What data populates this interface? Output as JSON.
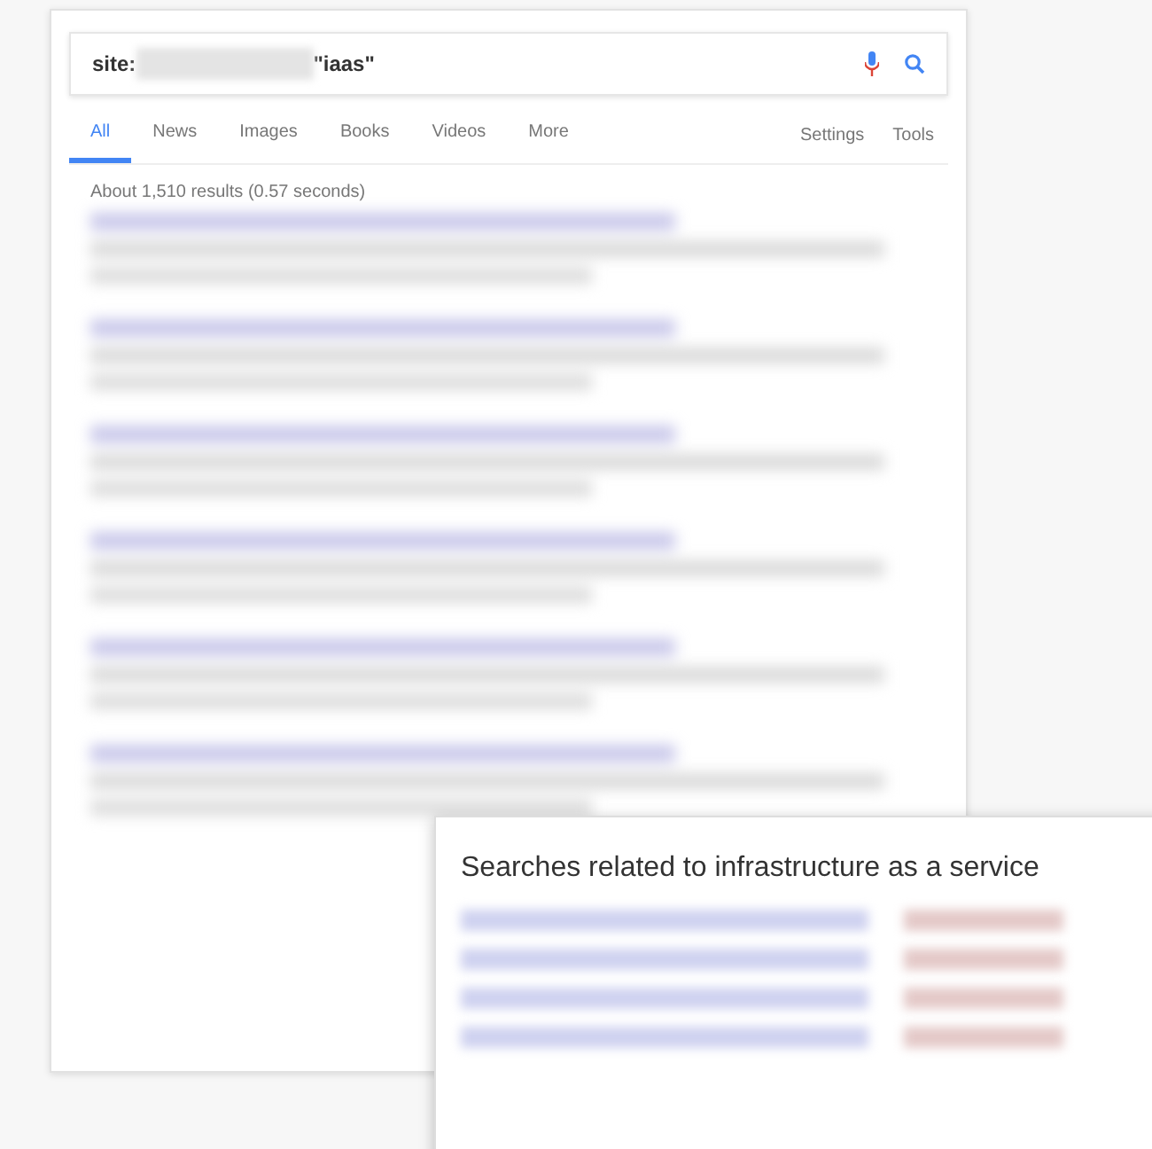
{
  "search": {
    "prefix": "site:",
    "suffix": "\"iaas\""
  },
  "tabs": [
    {
      "label": "All",
      "selected": true
    },
    {
      "label": "News",
      "selected": false
    },
    {
      "label": "Images",
      "selected": false
    },
    {
      "label": "Books",
      "selected": false
    },
    {
      "label": "Videos",
      "selected": false
    },
    {
      "label": "More",
      "selected": false
    }
  ],
  "tools": [
    "Settings",
    "Tools"
  ],
  "result_stats": "About 1,510 results (0.57 seconds)",
  "results": [
    {
      "kind": "redacted"
    },
    {
      "kind": "redacted"
    },
    {
      "kind": "redacted"
    },
    {
      "kind": "redacted"
    },
    {
      "kind": "redacted"
    },
    {
      "kind": "redacted"
    }
  ],
  "related": {
    "title": "Searches related to infrastructure as a service",
    "rows": [
      {
        "kind": "redacted"
      },
      {
        "kind": "redacted"
      },
      {
        "kind": "redacted"
      },
      {
        "kind": "redacted"
      }
    ]
  }
}
